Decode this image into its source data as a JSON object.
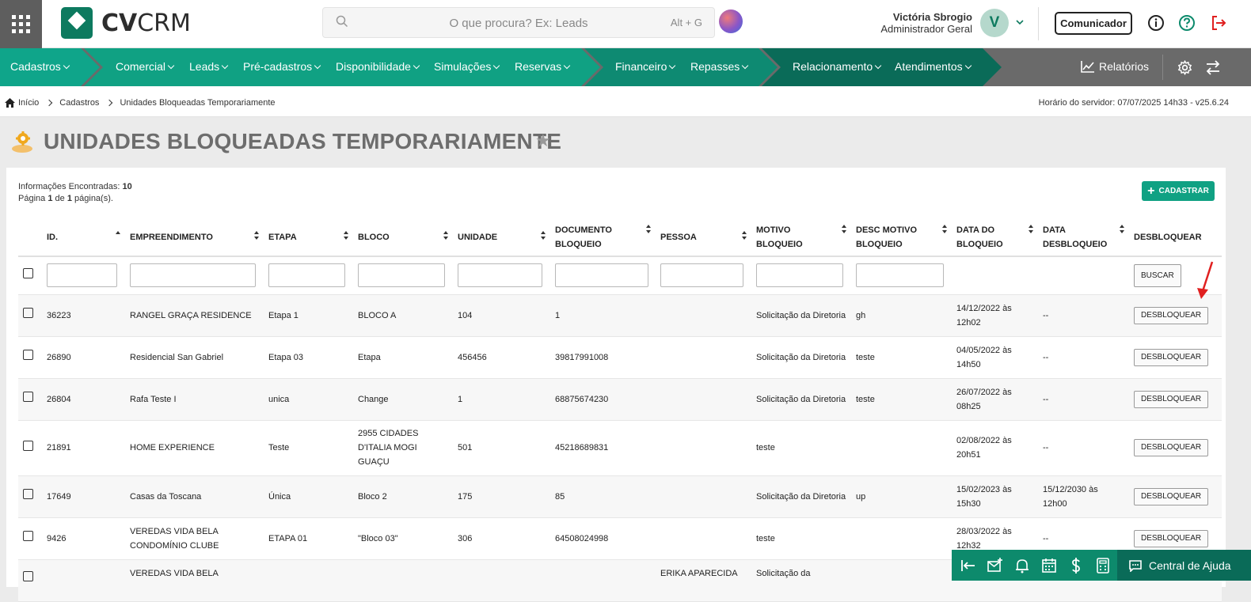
{
  "header": {
    "logo_bold": "CV",
    "logo_light": "CRM",
    "search_placeholder": "O que procura? Ex: Leads",
    "search_shortcut": "Alt + G",
    "user_name": "Victória Sbrogio",
    "user_role": "Administrador Geral",
    "avatar_letter": "V",
    "comunicador_label": "Comunicador"
  },
  "nav": {
    "items": [
      "Cadastros",
      "Comercial",
      "Leads",
      "Pré-cadastros",
      "Disponibilidade",
      "Simulações",
      "Reservas",
      "Financeiro",
      "Repasses",
      "Relacionamento",
      "Atendimentos"
    ],
    "relatorios": "Relatórios"
  },
  "breadcrumb": [
    "Início",
    "Cadastros",
    "Unidades Bloqueadas Temporariamente"
  ],
  "server_time": "Horário do servidor: 07/07/2025 14h33 - v25.6.24",
  "page_title": "UNIDADES BLOQUEADAS TEMPORARIAMENTE",
  "summary": {
    "found_label": "Informações Encontradas:",
    "found_value": "10",
    "page_prefix": "Página",
    "page_current": "1",
    "page_of": "de",
    "page_total": "1",
    "page_suffix": "página(s)."
  },
  "cadastrar_label": "CADASTRAR",
  "table": {
    "headers": [
      "ID.",
      "EMPREENDIMENTO",
      "ETAPA",
      "BLOCO",
      "UNIDADE",
      "DOCUMENTO BLOQUEIO",
      "PESSOA",
      "MOTIVO BLOQUEIO",
      "DESC MOTIVO BLOQUEIO",
      "DATA DO BLOQUEIO",
      "DATA DESBLOQUEIO",
      "DESBLOQUEAR"
    ],
    "buscar_label": "BUSCAR",
    "action_label": "DESBLOQUEAR",
    "rows": [
      {
        "id": "36223",
        "emp": "RANGEL GRAÇA RESIDENCE",
        "etapa": "Etapa 1",
        "bloco": "BLOCO A",
        "unidade": "104",
        "doc": "1",
        "pessoa": "",
        "motivo": "Solicitação da Diretoria",
        "desc": "gh",
        "data_bloq": "14/12/2022 às 12h02",
        "data_desbloq": "--"
      },
      {
        "id": "26890",
        "emp": "Residencial San Gabriel",
        "etapa": "Etapa 03",
        "bloco": "Etapa",
        "unidade": "456456",
        "doc": "39817991008",
        "pessoa": "",
        "motivo": "Solicitação da Diretoria",
        "desc": "teste",
        "data_bloq": "04/05/2022 às 14h50",
        "data_desbloq": "--"
      },
      {
        "id": "26804",
        "emp": "Rafa Teste I",
        "etapa": "unica",
        "bloco": "Change",
        "unidade": "1",
        "doc": "68875674230",
        "pessoa": "",
        "motivo": "Solicitação da Diretoria",
        "desc": "teste",
        "data_bloq": "26/07/2022 às 08h25",
        "data_desbloq": "--"
      },
      {
        "id": "21891",
        "emp": "HOME EXPERIENCE",
        "etapa": "Teste",
        "bloco": "2955 CIDADES D'ITALIA MOGI GUAÇU",
        "unidade": "501",
        "doc": "45218689831",
        "pessoa": "",
        "motivo": "teste",
        "desc": "",
        "data_bloq": "02/08/2022 às 20h51",
        "data_desbloq": "--"
      },
      {
        "id": "17649",
        "emp": "Casas da Toscana",
        "etapa": "Única",
        "bloco": "Bloco 2",
        "unidade": "175",
        "doc": "85",
        "pessoa": "",
        "motivo": "Solicitação da Diretoria",
        "desc": "up",
        "data_bloq": "15/02/2023 às 15h30",
        "data_desbloq": "15/12/2030 às 12h00"
      },
      {
        "id": "9426",
        "emp": "VEREDAS VIDA BELA CONDOMÍNIO CLUBE",
        "etapa": "ETAPA 01",
        "bloco": "\"Bloco 03\"",
        "unidade": "306",
        "doc": "64508024998",
        "pessoa": "",
        "motivo": "teste",
        "desc": "",
        "data_bloq": "28/03/2022 às 12h32",
        "data_desbloq": "--"
      },
      {
        "id": "",
        "emp": "VEREDAS VIDA BELA",
        "etapa": "",
        "bloco": "",
        "unidade": "",
        "doc": "",
        "pessoa": "ERIKA APARECIDA",
        "motivo": "Solicitação da",
        "desc": "",
        "data_bloq": "",
        "data_desbloq": ""
      }
    ]
  },
  "help_label": "Central de Ajuda",
  "colors": {
    "green": "#10a183",
    "dark_green": "#0a6b58",
    "nav_gray": "#6a6a6a",
    "accent_red": "#e02020"
  }
}
